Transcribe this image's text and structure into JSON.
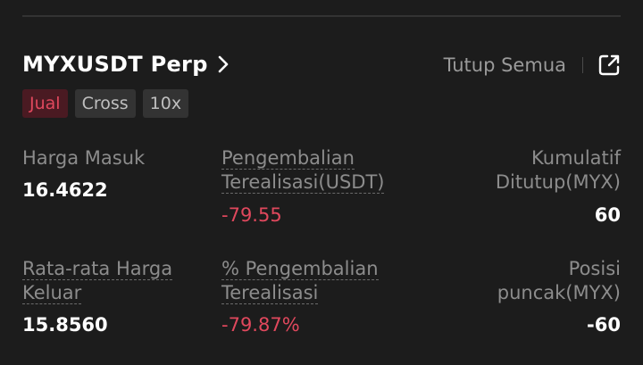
{
  "position": {
    "symbol": "MYXUSDT Perp",
    "close_all_label": "Tutup Semua",
    "badges": {
      "side": "Jual",
      "margin_mode": "Cross",
      "leverage": "10x"
    }
  },
  "stats": {
    "entry_price": {
      "label": "Harga Masuk",
      "value": "16.4622"
    },
    "realized_pnl": {
      "label_line1": "Pengembalian",
      "label_line2": "Terealisasi(USDT)",
      "value": "-79.55"
    },
    "cumulative_closed": {
      "label_line1": "Kumulatif",
      "label_line2": "Ditutup(MYX)",
      "value": "60"
    },
    "avg_exit_price": {
      "label_line1": "Rata-rata Harga",
      "label_line2": "Keluar",
      "value": "15.8560"
    },
    "realized_pnl_pct": {
      "label_line1": "% Pengembalian",
      "label_line2": "Terealisasi",
      "value": "-79.87%"
    },
    "peak_position": {
      "label_line1": "Posisi",
      "label_line2": "puncak(MYX)",
      "value": "-60"
    }
  },
  "colors": {
    "background": "#1c1c1c",
    "negative": "#e0485d",
    "label": "#8c8c8c",
    "sell_badge_bg": "#4a1a22"
  },
  "icons": {
    "symbol_chevron": "chevron-right-icon",
    "share": "share-external-icon"
  }
}
